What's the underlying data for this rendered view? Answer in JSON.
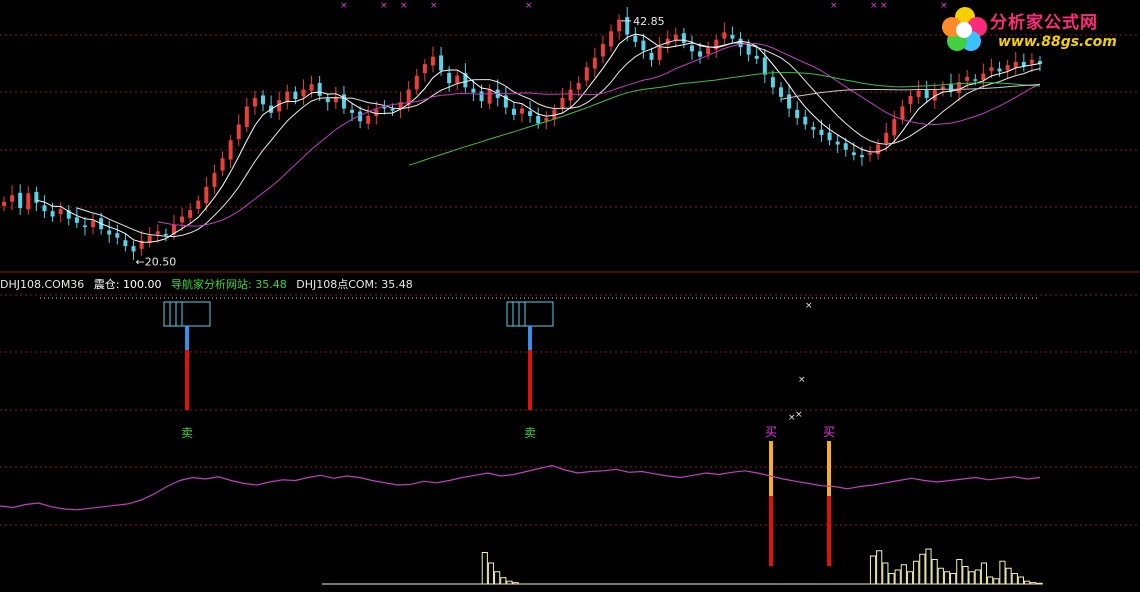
{
  "logo": {
    "title": "分析家公式网",
    "url": "www.88gs.com"
  },
  "indicator_header": {
    "name": "DHJ108.COM36",
    "position_label": "震仓: 100.00",
    "site_label": "导航家分析网站: 35.48",
    "site2_label": "DHJ108点COM: 35.48"
  },
  "colors": {
    "background": "#000000",
    "up_candle": "#e8403c",
    "down_candle": "#5ad2e8",
    "ma5": "#ffffff",
    "ma10": "#e8e8e8",
    "ma20": "#c040c0",
    "ma60": "#40c040",
    "ma120": "#c8c8c8",
    "grid": "#8b1a1a",
    "sell_label": "#3cd43c",
    "buy_label": "#e040e0",
    "purple_line": "#c040c0",
    "volume": "#f5f0b0"
  },
  "chart_data": [
    {
      "type": "candlestick",
      "annotations": [
        {
          "text": "42.85",
          "label": "high"
        },
        {
          "text": "←20.50",
          "label": "low"
        }
      ],
      "price_high": 42.85,
      "price_low": 20.5,
      "series": [
        {
          "name": "price",
          "values": [
            25.2,
            25.8,
            24.6,
            26.0,
            25.1,
            24.3,
            23.8,
            24.5,
            23.6,
            23.2,
            22.8,
            23.4,
            22.6,
            22.1,
            21.8,
            21.0,
            20.5,
            21.5,
            22.0,
            22.4,
            22.1,
            23.0,
            23.8,
            24.4,
            25.3,
            26.6,
            27.9,
            29.3,
            31.0,
            32.5,
            34.2,
            35.0,
            34.4,
            33.6,
            34.8,
            35.6,
            34.9,
            35.8,
            36.3,
            35.2,
            34.6,
            35.1,
            34.0,
            33.6,
            32.8,
            33.3,
            33.9,
            34.1,
            33.8,
            34.6,
            35.8,
            37.1,
            38.2,
            38.9,
            37.6,
            36.4,
            37.1,
            36.0,
            35.5,
            34.7,
            35.8,
            35.0,
            34.1,
            33.4,
            34.0,
            33.3,
            32.6,
            33.1,
            33.9,
            35.0,
            35.8,
            36.4,
            37.9,
            38.8,
            40.1,
            41.3,
            42.4,
            41.0,
            40.3,
            39.5,
            38.6,
            39.8,
            40.6,
            41.0,
            40.2,
            39.4,
            38.9,
            39.7,
            40.5,
            41.2,
            40.6,
            39.8,
            39.1,
            38.7,
            37.2,
            36.0,
            35.1,
            34.0,
            33.1,
            32.5,
            32.0,
            31.5,
            31.0,
            30.6,
            30.1,
            29.6,
            29.4,
            29.8,
            30.6,
            31.7,
            33.0,
            34.2,
            35.2,
            35.7,
            35.0,
            35.8,
            36.1,
            35.6,
            36.5,
            37.0,
            36.7,
            37.3,
            37.9,
            37.5,
            38.1,
            38.4,
            38.0,
            38.6,
            38.2
          ]
        }
      ],
      "moving_averages": [
        "ma5",
        "ma10",
        "ma20",
        "ma60",
        "ma120"
      ]
    },
    {
      "type": "indicator",
      "signals": [
        {
          "label": "卖",
          "kind": "sell"
        },
        {
          "label": "卖",
          "kind": "sell"
        },
        {
          "label": "买",
          "kind": "buy"
        },
        {
          "label": "买",
          "kind": "buy"
        }
      ],
      "purple_line": [
        0.32,
        0.3,
        0.34,
        0.36,
        0.31,
        0.28,
        0.27,
        0.29,
        0.31,
        0.33,
        0.35,
        0.4,
        0.48,
        0.58,
        0.66,
        0.7,
        0.68,
        0.71,
        0.66,
        0.62,
        0.6,
        0.64,
        0.67,
        0.66,
        0.7,
        0.73,
        0.69,
        0.72,
        0.7,
        0.66,
        0.63,
        0.6,
        0.61,
        0.65,
        0.63,
        0.66,
        0.7,
        0.73,
        0.76,
        0.72,
        0.74,
        0.78,
        0.82,
        0.86,
        0.8,
        0.76,
        0.78,
        0.79,
        0.81,
        0.77,
        0.78,
        0.75,
        0.72,
        0.7,
        0.73,
        0.76,
        0.74,
        0.77,
        0.79,
        0.76,
        0.72,
        0.68,
        0.65,
        0.62,
        0.59,
        0.58,
        0.55,
        0.58,
        0.6,
        0.63,
        0.66,
        0.69,
        0.66,
        0.64,
        0.66,
        0.68,
        0.7,
        0.67,
        0.69,
        0.71,
        0.68,
        0.7
      ],
      "volume": [
        0,
        0,
        0,
        0,
        0,
        0,
        0,
        0,
        0,
        0,
        0,
        0,
        0,
        0,
        0,
        0,
        0,
        0,
        0,
        0,
        0,
        0,
        0,
        0,
        0,
        0,
        0.9,
        0.6,
        0.35,
        0.18,
        0.08,
        0.04,
        0,
        0,
        0,
        0,
        0,
        0,
        0,
        0,
        0,
        0,
        0,
        0,
        0,
        0,
        0,
        0,
        0,
        0,
        0,
        0,
        0,
        0,
        0,
        0,
        0,
        0,
        0,
        0,
        0,
        0,
        0,
        0,
        0,
        0,
        0,
        0,
        0,
        0,
        0,
        0,
        0,
        0,
        0,
        0,
        0,
        0,
        0,
        0,
        0,
        0,
        0,
        0,
        0,
        0,
        0,
        0,
        0,
        0.8,
        0.95,
        0.6,
        0.3,
        0.4,
        0.55,
        0.35,
        0.65,
        0.85,
        1.0,
        0.7,
        0.45,
        0.35,
        0.3,
        0.7,
        0.5,
        0.35,
        0.4,
        0.6,
        0.2,
        0.15,
        0.65,
        0.45,
        0.3,
        0.2,
        0.08,
        0.04,
        0.02
      ]
    }
  ]
}
